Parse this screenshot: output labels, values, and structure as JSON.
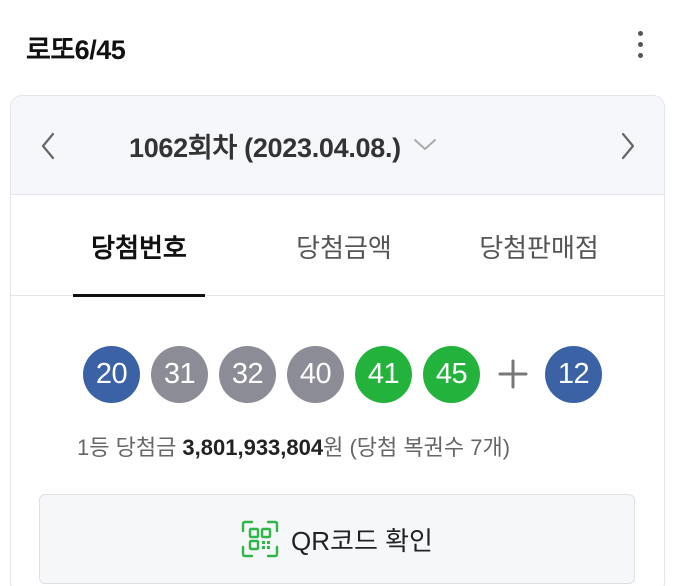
{
  "app": {
    "title": "로또6/45"
  },
  "round": {
    "label": "1062회차 (2023.04.08.)",
    "chevron": "chevron-down-icon"
  },
  "tabs": [
    {
      "label": "당첨번호",
      "active": true
    },
    {
      "label": "당첨금액",
      "active": false
    },
    {
      "label": "당첨판매점",
      "active": false
    }
  ],
  "numbers": [
    {
      "value": "20",
      "color": "#3a62a4"
    },
    {
      "value": "31",
      "color": "#8c8c96"
    },
    {
      "value": "32",
      "color": "#8c8c96"
    },
    {
      "value": "40",
      "color": "#8c8c96"
    },
    {
      "value": "41",
      "color": "#23b33c"
    },
    {
      "value": "45",
      "color": "#23b33c"
    }
  ],
  "bonus": {
    "value": "12",
    "color": "#3a62a4"
  },
  "prize": {
    "prefix": "1등 당첨금 ",
    "amount": "3,801,933,804",
    "suffix": "원 (당첨 복권수 7개)"
  },
  "qr_button": {
    "label": "QR코드 확인",
    "icon": "qr-code-icon",
    "color": "#2fb648"
  }
}
